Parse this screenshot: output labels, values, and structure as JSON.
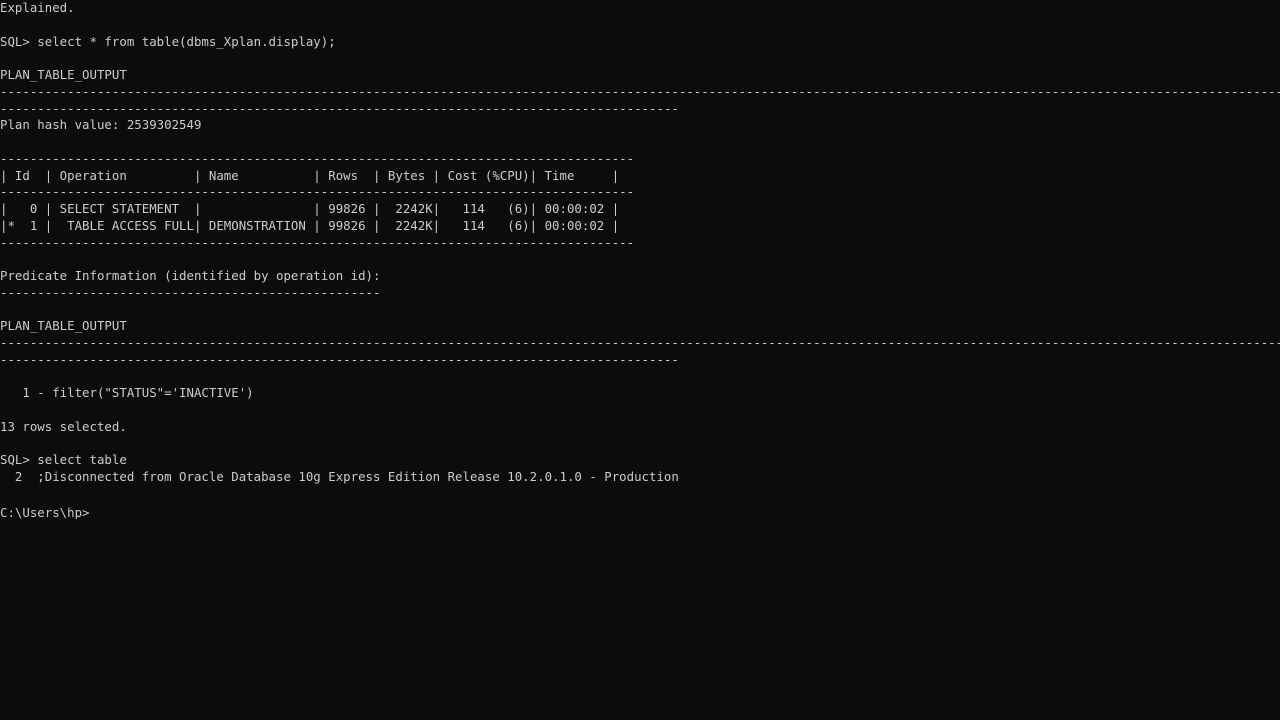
{
  "terminal": {
    "lines": [
      "Explained.",
      "",
      "SQL> select * from table(dbms_Xplan.display);",
      "",
      "PLAN_TABLE_OUTPUT",
      "--------------------------------------------------------------------------------------------------------------------------------------------------------------------------------------",
      "-------------------------------------------------------------------------------------------",
      "Plan hash value: 2539302549",
      "",
      "-------------------------------------------------------------------------------------",
      "| Id  | Operation         | Name          | Rows  | Bytes | Cost (%CPU)| Time     |",
      "-------------------------------------------------------------------------------------",
      "|   0 | SELECT STATEMENT  |               | 99826 |  2242K|   114   (6)| 00:00:02 |",
      "|*  1 |  TABLE ACCESS FULL| DEMONSTRATION | 99826 |  2242K|   114   (6)| 00:00:02 |",
      "-------------------------------------------------------------------------------------",
      "",
      "Predicate Information (identified by operation id):",
      "---------------------------------------------------",
      "",
      "PLAN_TABLE_OUTPUT",
      "--------------------------------------------------------------------------------------------------------------------------------------------------------------------------------------",
      "-------------------------------------------------------------------------------------------",
      "",
      "   1 - filter(\"STATUS\"='INACTIVE')",
      "",
      "13 rows selected.",
      "",
      "SQL> select table",
      "  2  ;Disconnected from Oracle Database 10g Express Edition Release 10.2.0.1.0 - Production",
      "",
      "C:\\Users\\hp>"
    ]
  },
  "colors": {
    "background": "#0c0c0c",
    "text": "#cccccc"
  }
}
